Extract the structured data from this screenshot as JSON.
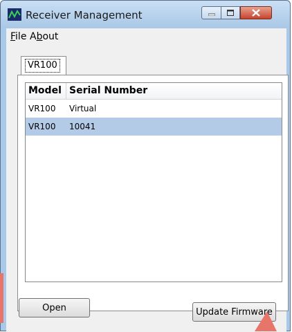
{
  "window": {
    "title": "Receiver Management",
    "icon": "chart-window-icon",
    "controls": [
      "minimize-icon",
      "maximize-icon",
      "close-icon"
    ]
  },
  "menu": {
    "file_prefix": "",
    "file_u": "F",
    "file_rest": "ile",
    "about_prefix": "A",
    "about_u": "b",
    "about_rest": "out"
  },
  "tabs": [
    {
      "label": "VR100"
    }
  ],
  "list": {
    "columns": [
      "Model",
      "Serial Number"
    ],
    "rows": [
      {
        "model": "VR100",
        "serial": "Virtual",
        "selected": false
      },
      {
        "model": "VR100",
        "serial": "10041",
        "selected": true
      }
    ]
  },
  "buttons": {
    "open": "Open",
    "update_firmware": "Update Firmware"
  },
  "colors": {
    "titlebar": "#a9c7e6",
    "close_button": "#c6452d",
    "selection": "#b4cbe8",
    "annotation_arrow": "#e8756a"
  }
}
